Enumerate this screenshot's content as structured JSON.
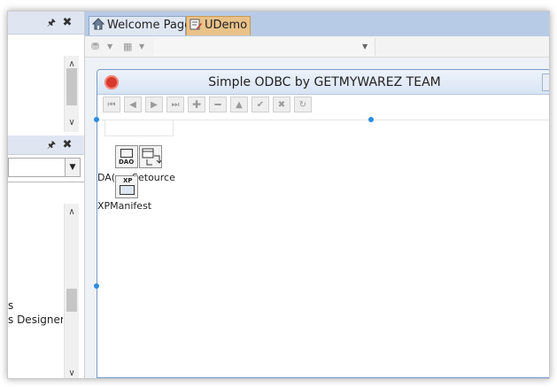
{
  "tabs": [
    {
      "label": "Welcome Page",
      "icon": "home-icon"
    },
    {
      "label": "UDemo",
      "icon": "form-edit-icon"
    }
  ],
  "left_pane": {
    "lower_list_items": [
      "s",
      "s Designer"
    ]
  },
  "form": {
    "title": "Simple ODBC by GETMYWAREZ TEAM",
    "nav_buttons": [
      "first",
      "prior",
      "next",
      "last",
      "insert",
      "delete",
      "edit",
      "post",
      "cancel",
      "refresh"
    ],
    "components": [
      {
        "badge": "DAO",
        "label": "DA("
      },
      {
        "label": "Setource"
      },
      {
        "badge": "XP",
        "label": "XPManifest"
      }
    ]
  },
  "colors": {
    "tab_active": "#e9c28a",
    "tab_inactive": "#dfe7f3",
    "accent_handle": "#2a8be0",
    "logo": "#d9382b"
  }
}
